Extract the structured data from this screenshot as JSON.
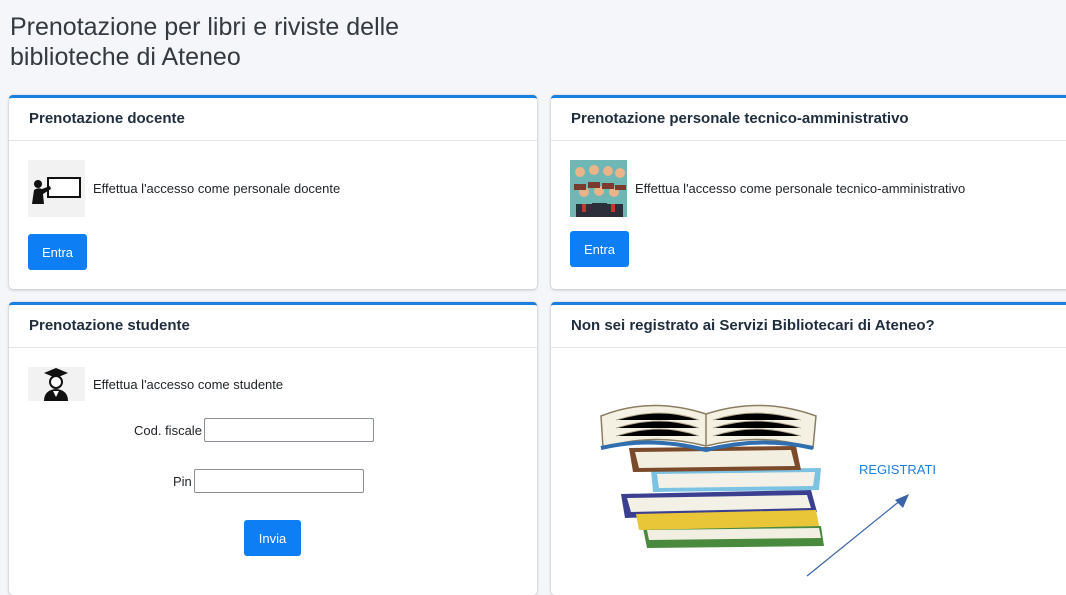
{
  "page": {
    "title": "Prenotazione per libri e riviste delle biblioteche di Ateneo"
  },
  "cards": {
    "docente": {
      "header": "Prenotazione docente",
      "icon": "teacher-at-board-icon",
      "text": "Effettua l'accesso come personale docente",
      "button": "Entra"
    },
    "tecnico": {
      "header": "Prenotazione personale tecnico-amministrativo",
      "icon": "staff-group-icon",
      "text": "Effettua l'accesso come personale tecnico-amministrativo",
      "button": "Entra"
    },
    "studente": {
      "header": "Prenotazione studente",
      "icon": "graduate-student-icon",
      "text": "Effettua l'accesso come studente",
      "codfiscale_label": "Cod. fiscale",
      "codfiscale_value": "",
      "pin_label": "Pin",
      "pin_value": "",
      "button": "Invia"
    },
    "registrazione": {
      "header": "Non sei registrato ai Servizi Bibliotecari di Ateneo?",
      "image": "book-stack-illustration",
      "link": "REGISTRATI",
      "annotation": "arrow-pointing-to-link"
    }
  },
  "colors": {
    "accent": "#1b7fe0",
    "button": "#0d7ef3",
    "background": "#f4f6f9"
  }
}
